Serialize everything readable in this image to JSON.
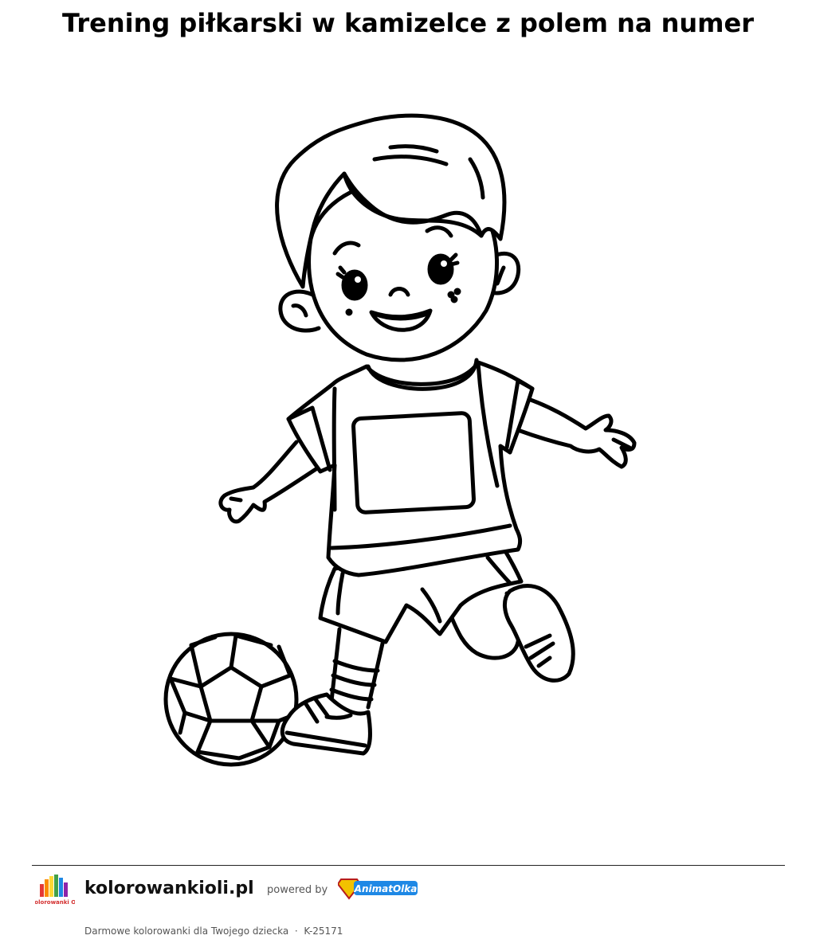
{
  "page": {
    "title": "Trening piłkarski w kamizelce z polem na numer"
  },
  "illustration": {
    "subject": "boy-kicking-soccer-ball",
    "line_color": "#000000",
    "background": "#ffffff"
  },
  "footer": {
    "logo_text": "Kolorowanki Oli",
    "site_name": "kolorowankioli.pl",
    "powered_by": "powered by",
    "partner_name": "AnimatOlka",
    "tagline": "Darmowe kolorowanki dla Twojego dziecka",
    "separator": "·",
    "code": "K-25171"
  }
}
